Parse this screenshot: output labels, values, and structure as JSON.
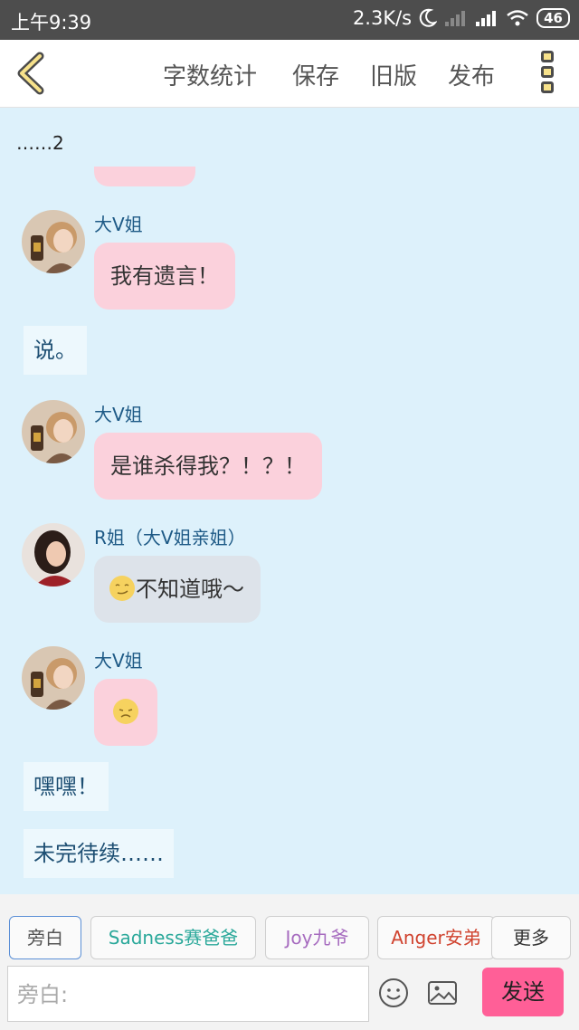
{
  "status_bar": {
    "time": "上午9:39",
    "speed": "2.3K/s",
    "battery": "46"
  },
  "toolbar": {
    "word_count": "字数统计",
    "save": "保存",
    "old_version": "旧版",
    "publish": "发布"
  },
  "chat": {
    "truncated_text": "……2",
    "messages": [
      {
        "speaker": "大V姐",
        "text": "我有遗言！"
      },
      {
        "narration": "说。"
      },
      {
        "speaker": "大V姐",
        "text": "是谁杀得我？！？！"
      },
      {
        "speaker": "R姐（大V姐亲姐）",
        "text": "不知道哦～"
      },
      {
        "speaker": "大V姐",
        "text": ""
      },
      {
        "narration": "嘿嘿！"
      },
      {
        "narration": "未完待续……"
      }
    ]
  },
  "roles": [
    {
      "label": "旁白",
      "color": "#555555"
    },
    {
      "label": "Sadness赛爸爸",
      "color": "#2aa89a"
    },
    {
      "label": "Joy九爷",
      "color": "#a66bbf"
    },
    {
      "label": "Anger安弟",
      "color": "#d0432f"
    }
  ],
  "more_label": "更多",
  "input": {
    "placeholder": "旁白:"
  },
  "send_label": "发送",
  "colors": {
    "pink_bubble": "#fbd1dc",
    "chat_bg": "#ddf1fb",
    "send": "#ff5f97"
  }
}
